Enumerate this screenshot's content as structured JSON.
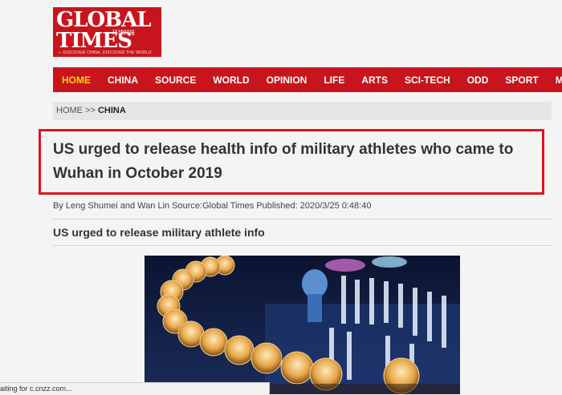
{
  "logo": {
    "line1": "GLOBAL",
    "line2": "TIMES",
    "chinese": "环球时报",
    "tagline": "— DISCOVER CHINA, DISCOVER THE WORLD"
  },
  "nav": {
    "items": [
      "HOME",
      "CHINA",
      "SOURCE",
      "WORLD",
      "OPINION",
      "LIFE",
      "ARTS",
      "SCI-TECH",
      "ODD",
      "SPORT",
      "METRO"
    ],
    "active": "HOME"
  },
  "breadcrumb": {
    "home": "HOME >>",
    "section": "CHINA"
  },
  "article": {
    "title": "US urged to release health info of military athletes who came to Wuhan in October 2019",
    "byline": "By Leng Shumei and Wan Lin Source:Global Times Published: 2020/3/25 0:48:40",
    "subheading": "US urged to release military athlete info"
  },
  "status_bar": {
    "text": "aiting for c.cnzz.com..."
  },
  "colors": {
    "brand_red": "#c8151d",
    "highlight_box": "#e0141e",
    "active_nav": "#ffd400"
  }
}
